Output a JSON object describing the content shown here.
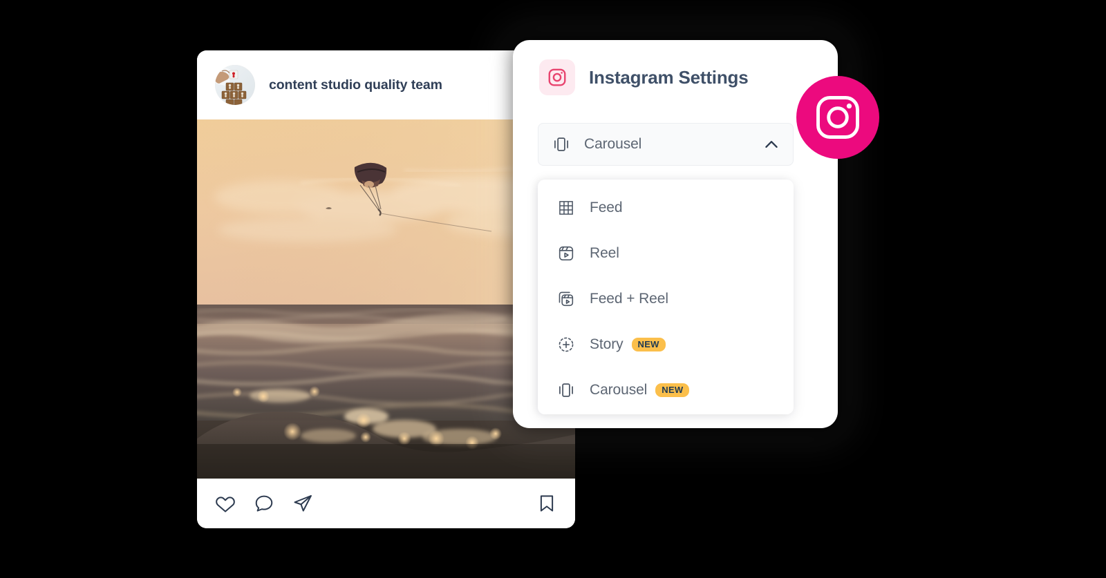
{
  "background_color": "#000000",
  "post": {
    "username": "content studio quality team",
    "avatar_alt": "hand stacking wooden blocks with person icons",
    "media_alt": "sunset over ocean waves with a parasail in the sky",
    "actions": [
      {
        "name": "like",
        "icon": "heart-icon"
      },
      {
        "name": "comment",
        "icon": "comment-icon"
      },
      {
        "name": "share",
        "icon": "paper-plane-icon"
      }
    ],
    "save_action": {
      "name": "save",
      "icon": "bookmark-icon"
    }
  },
  "settings_panel": {
    "icon": "instagram-icon",
    "icon_color": "#e8436e",
    "icon_tile_color": "#fdeaf0",
    "title": "Instagram Settings",
    "select": {
      "icon": "carousel-icon",
      "value": "Carousel",
      "caret": "chevron-up-icon",
      "expanded": true
    },
    "options": [
      {
        "label": "Feed",
        "icon": "grid-icon",
        "badge": ""
      },
      {
        "label": "Reel",
        "icon": "reel-icon",
        "badge": ""
      },
      {
        "label": "Feed + Reel",
        "icon": "feed-reel-icon",
        "badge": ""
      },
      {
        "label": "Story",
        "icon": "story-plus-icon",
        "badge": "NEW"
      },
      {
        "label": "Carousel",
        "icon": "carousel-icon",
        "badge": "NEW"
      }
    ],
    "badge_color": "#fbbf4b",
    "badge_text_color": "#1f3a52"
  },
  "floating_badge": {
    "icon": "instagram-icon",
    "color": "#ec0a7e"
  }
}
